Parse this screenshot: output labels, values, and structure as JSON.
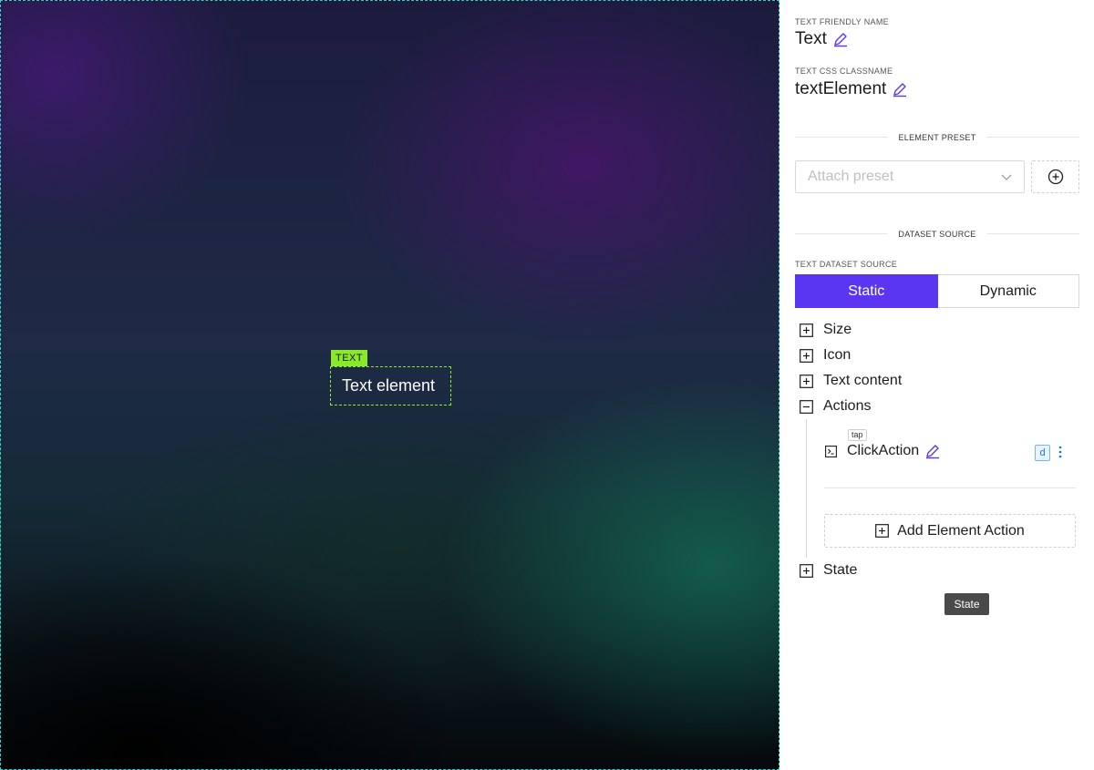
{
  "canvas": {
    "element_tag": "TEXT",
    "element_text": "Text element"
  },
  "panel": {
    "friendly_name_label": "TEXT FRIENDLY NAME",
    "friendly_name_value": "Text",
    "css_classname_label": "TEXT CSS CLASSNAME",
    "css_classname_value": "textElement",
    "element_preset_heading": "ELEMENT PRESET",
    "preset_placeholder": "Attach preset",
    "dataset_source_heading": "DATASET SOURCE",
    "text_dataset_source_label": "TEXT DATASET SOURCE",
    "dataset_options": [
      "Static",
      "Dynamic"
    ],
    "dataset_selected": "Static",
    "tree": {
      "size": "Size",
      "icon": "Icon",
      "text_content": "Text content",
      "actions": "Actions",
      "state": "State"
    },
    "action": {
      "trigger": "tap",
      "name": "ClickAction",
      "badge": "d"
    },
    "add_action_label": "Add Element Action",
    "tooltip": "State"
  },
  "colors": {
    "accent": "#5b36f2",
    "canvas_border": "#2fd3c9",
    "element_tag_bg": "#8aea2a",
    "pencil": "#5b36f2"
  },
  "icons": [
    "pencil-icon",
    "chevron-down-icon",
    "plus-circle-icon",
    "plus-square-icon",
    "minus-square-icon",
    "terminal-icon",
    "more-vertical-icon"
  ]
}
